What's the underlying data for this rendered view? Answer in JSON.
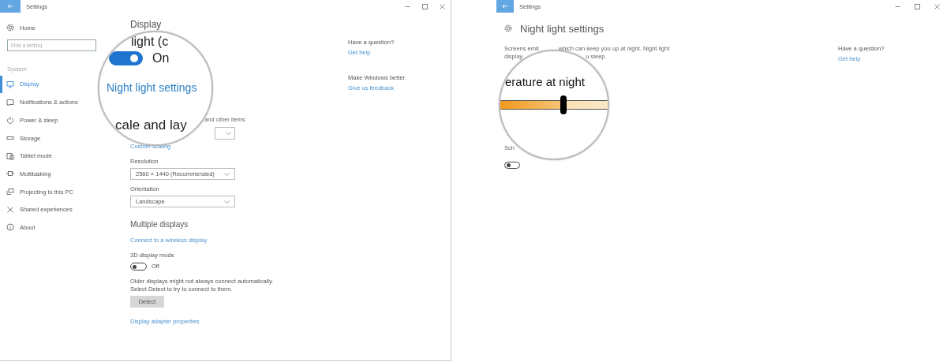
{
  "left_window": {
    "title": "Settings",
    "sidebar": {
      "home": "Home",
      "search": {
        "placeholder": "Find a setting"
      },
      "section": "System",
      "items": [
        {
          "label": "Display",
          "selected": true
        },
        {
          "label": "Notifications & actions",
          "selected": false
        },
        {
          "label": "Power & sleep",
          "selected": false
        },
        {
          "label": "Storage",
          "selected": false
        },
        {
          "label": "Tablet mode",
          "selected": false
        },
        {
          "label": "Multitasking",
          "selected": false
        },
        {
          "label": "Projecting to this PC",
          "selected": false
        },
        {
          "label": "Shared experiences",
          "selected": false
        },
        {
          "label": "About",
          "selected": false
        }
      ]
    },
    "content": [
      {
        "kind": "heading",
        "text": "Display"
      },
      {
        "kind": "fragment",
        "text": ", and other items"
      },
      {
        "kind": "dropdown"
      },
      {
        "kind": "link",
        "text": "Custom scaling"
      },
      {
        "kind": "label",
        "text": "Resolution"
      },
      {
        "kind": "dropdown",
        "value": "2560 × 1440 (Recommended)"
      },
      {
        "kind": "label",
        "text": "Orientation"
      },
      {
        "kind": "dropdown",
        "value": "Landscape"
      },
      {
        "kind": "subheading",
        "text": "Multiple displays"
      },
      {
        "kind": "link",
        "text": "Connect to a wireless display"
      },
      {
        "kind": "label",
        "text": "3D display mode"
      },
      {
        "kind": "toggle",
        "on": false,
        "label": "Off"
      },
      {
        "kind": "paragraph",
        "text": "Older displays might not always connect automatically. Select Detect to try to connect to them."
      },
      {
        "kind": "button",
        "text": "Detect"
      },
      {
        "kind": "link",
        "text": "Display adapter properties"
      }
    ],
    "help": [
      {
        "question": "Have a question?",
        "link": "Get help"
      },
      {
        "question": "Make Windows better.",
        "link": "Give us feedback"
      }
    ]
  },
  "left_magnifier": {
    "items": [
      {
        "kind": "partial",
        "text": "light (c"
      },
      {
        "kind": "toggle",
        "on": true,
        "label": "On"
      },
      {
        "kind": "link",
        "text": "Night light settings"
      },
      {
        "kind": "partial",
        "text": "cale and lay"
      }
    ]
  },
  "right_window": {
    "title": "Settings",
    "heading": "Night light settings",
    "description": [
      [
        "Screens emit",
        "which can keep you up at night. Night light"
      ],
      [
        "display",
        "u sleep."
      ]
    ],
    "schedule_label": "Sch",
    "schedule_toggle": {
      "on": false
    },
    "help": [
      {
        "question": "Have a question?",
        "link": "Get help"
      }
    ]
  },
  "right_magnifier": {
    "label": "erature at night",
    "slider": {
      "level": 0.59
    }
  }
}
